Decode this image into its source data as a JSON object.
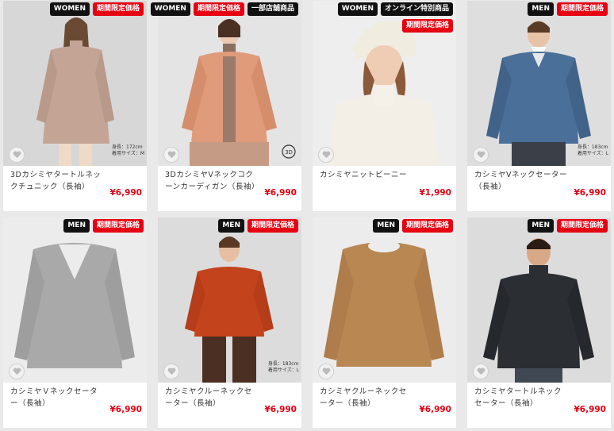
{
  "products": [
    {
      "badges": [
        "WOMEN",
        "期間限定価格"
      ],
      "title": "3Dカシミヤタートルネックチュニック（長袖）",
      "price": "¥6,990",
      "size_note": "身長：172cm\n着用サイズ：M",
      "colors": {
        "bg": "#d7d7d7",
        "garment": "#c4a595"
      }
    },
    {
      "badges": [
        "WOMEN",
        "期間限定価格",
        "一部店舗商品"
      ],
      "title": "3DカシミヤVネックコクーンカーディガン（長袖）",
      "price": "¥6,990",
      "knit_label": "3D KNIT",
      "colors": {
        "bg": "#e4e4e4",
        "garment": "#df9b7a"
      }
    },
    {
      "badges": [
        "WOMEN",
        "オンライン特別商品"
      ],
      "sub_badge": "期間限定価格",
      "title": "カシミヤニットビーニー",
      "price": "¥1,990",
      "colors": {
        "bg": "#eeeeee",
        "garment": "#f1ece0"
      }
    },
    {
      "badges": [
        "MEN",
        "期間限定価格"
      ],
      "title": "カシミヤVネックセーター（長袖）",
      "price": "¥6,990",
      "size_note": "身長：183cm\n着用サイズ：L",
      "colors": {
        "bg": "#dedede",
        "garment": "#4a6f99"
      }
    },
    {
      "badges": [
        "MEN",
        "期間限定価格"
      ],
      "title": "カシミヤＶネックセーター（長袖）",
      "price": "¥6,990",
      "colors": {
        "bg": "#ececec",
        "garment": "#a9a9a9"
      }
    },
    {
      "badges": [
        "MEN",
        "期間限定価格"
      ],
      "title": "カシミヤクルーネックセーター（長袖）",
      "price": "¥6,990",
      "size_note": "身長：183cm\n着用サイズ：L",
      "colors": {
        "bg": "#dcdcdc",
        "garment": "#c3431c"
      }
    },
    {
      "badges": [
        "MEN",
        "期間限定価格"
      ],
      "title": "カシミヤクルーネックセーター（長袖）",
      "price": "¥6,990",
      "colors": {
        "bg": "#ececec",
        "garment": "#b98752"
      }
    },
    {
      "badges": [
        "MEN",
        "期間限定価格"
      ],
      "title": "カシミヤタートルネックセーター（長袖）",
      "price": "¥6,990",
      "colors": {
        "bg": "#dcdcdc",
        "garment": "#2b2e33"
      }
    }
  ],
  "icons": {
    "favorite": "heart-icon"
  }
}
